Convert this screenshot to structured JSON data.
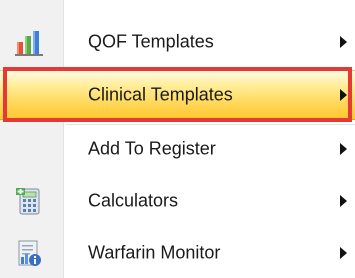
{
  "menu": {
    "items": [
      {
        "label": "QOF Templates",
        "icon": "bar-chart-icon",
        "has_submenu": true,
        "highlighted": false
      },
      {
        "label": "Clinical Templates",
        "icon": "",
        "has_submenu": true,
        "highlighted": true
      },
      {
        "label": "Add To Register",
        "icon": "",
        "has_submenu": true,
        "highlighted": false
      },
      {
        "label": "Calculators",
        "icon": "calculator-icon",
        "has_submenu": true,
        "highlighted": false
      },
      {
        "label": "Warfarin Monitor",
        "icon": "warfarin-monitor-icon",
        "has_submenu": true,
        "highlighted": false
      }
    ]
  },
  "colors": {
    "highlight_top": "#fff6c4",
    "highlight_bottom": "#ffc82e",
    "callout_border": "#e53935",
    "text": "#1a1a1a",
    "gutter": "#f1f1f1"
  }
}
